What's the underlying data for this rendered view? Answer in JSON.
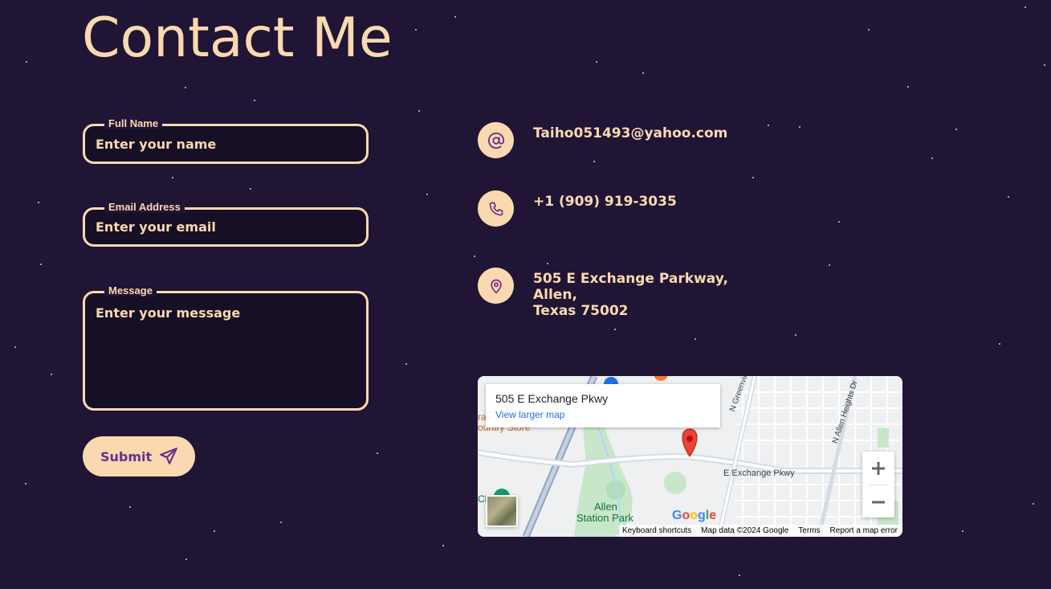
{
  "page": {
    "title": "Contact Me"
  },
  "form": {
    "name": {
      "label": "Full Name",
      "placeholder": "Enter your name"
    },
    "email": {
      "label": "Email Address",
      "placeholder": "Enter your email"
    },
    "message": {
      "label": "Message",
      "placeholder": "Enter your message"
    },
    "submit_label": "Submit"
  },
  "contact": {
    "email": "Taiho051493@yahoo.com",
    "phone": "+1 (909) 919-3035",
    "address_line1": "505 E Exchange Parkway, Allen,",
    "address_line2": "Texas 75002"
  },
  "map": {
    "place_name": "505 E Exchange Pkwy",
    "view_larger": "View larger map",
    "road_label": "E Exchange Pkwy",
    "park_label_1": "Allen",
    "park_label_2": "Station Park",
    "street_label_1": "N Greenville",
    "street_label_2": "N Allen Heights Dr",
    "store_label": "ountry Store",
    "store_label_prefix": "ra",
    "cl_label": "Cl",
    "google_logo": "Google",
    "attrib": {
      "shortcuts": "Keyboard shortcuts",
      "data": "Map data ©2024 Google",
      "terms": "Terms",
      "report": "Report a map error"
    }
  },
  "colors": {
    "background": "#201535",
    "accent": "#fbd9b0",
    "icon": "#6d2e8c"
  },
  "icons": {
    "email": "at-icon",
    "phone": "phone-icon",
    "address": "location-pin-icon",
    "submit": "send-icon"
  }
}
